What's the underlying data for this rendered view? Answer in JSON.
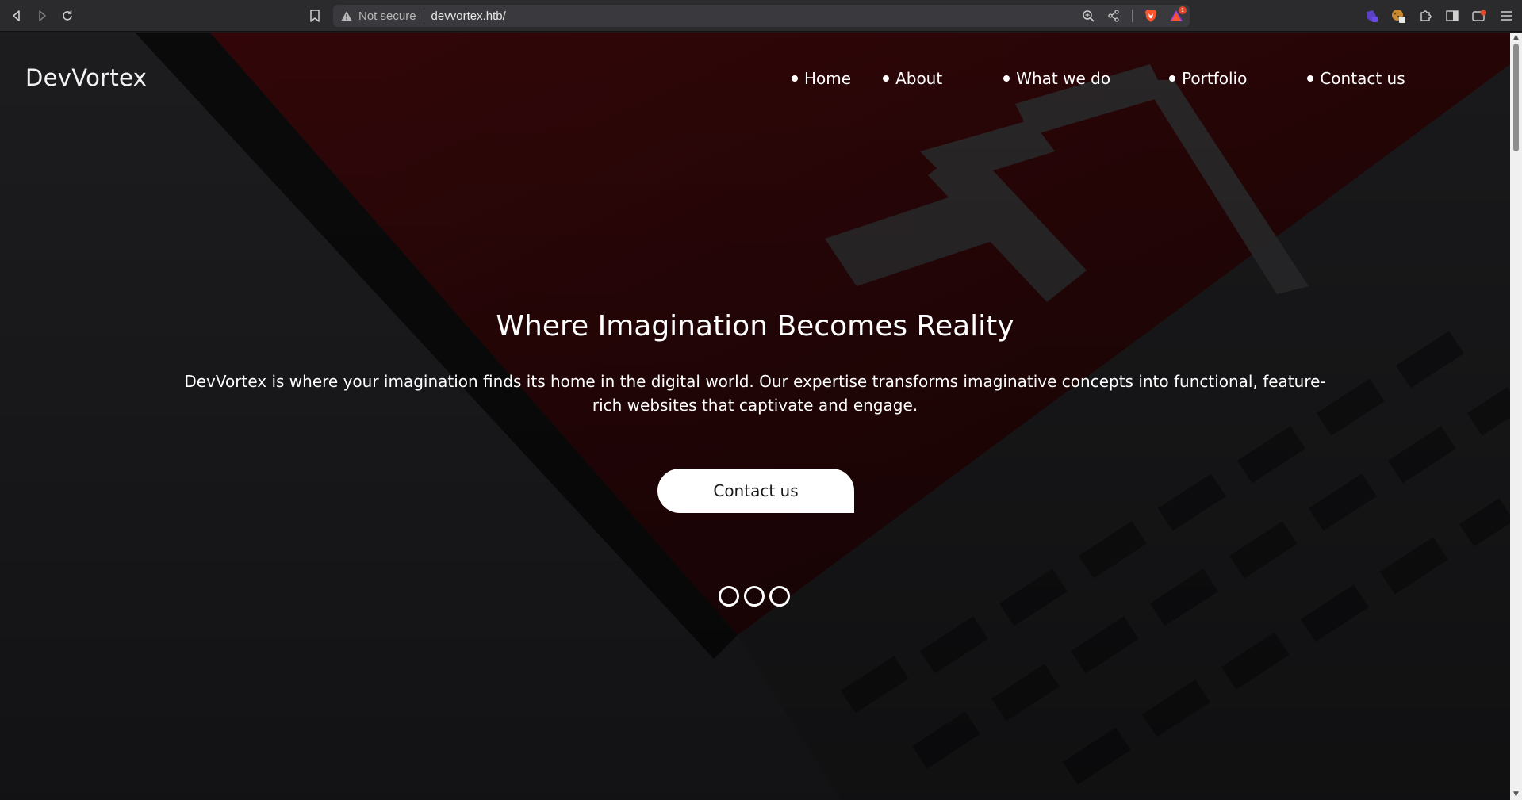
{
  "browser": {
    "security_label": "Not secure",
    "url": "devvortex.htb/",
    "icons": {
      "back": "back-arrow-icon",
      "forward": "forward-arrow-icon",
      "reload": "reload-icon",
      "bookmark": "bookmark-icon",
      "warning": "warning-triangle-icon",
      "zoom": "zoom-icon",
      "share": "share-icon",
      "brave_shield": "brave-lion-icon",
      "brave_rewards": "brave-rewards-icon",
      "extensions": "puzzle-icon",
      "sidebar": "sidebar-icon",
      "wallet": "wallet-icon",
      "menu": "hamburger-menu-icon"
    },
    "rewards_badge": "1",
    "colors": {
      "chrome": "#2b2b2e",
      "urlbar": "#3a3a3e",
      "brave": "#fb542b"
    }
  },
  "site": {
    "brand": "DevVortex",
    "nav": [
      {
        "label": "Home"
      },
      {
        "label": "About"
      },
      {
        "label": "What we do"
      },
      {
        "label": "Portfolio"
      },
      {
        "label": "Contact us"
      }
    ],
    "hero": {
      "title": "Where Imagination Becomes Reality",
      "text": "DevVortex is where your imagination finds its home in the digital world. Our expertise transforms imaginative concepts into functional, feature-rich websites that captivate and engage.",
      "button_label": "Contact us",
      "slides": 3
    },
    "colors": {
      "background": "#1c1c1f",
      "accent_red": "#2a0709",
      "text": "#ffffff"
    }
  }
}
